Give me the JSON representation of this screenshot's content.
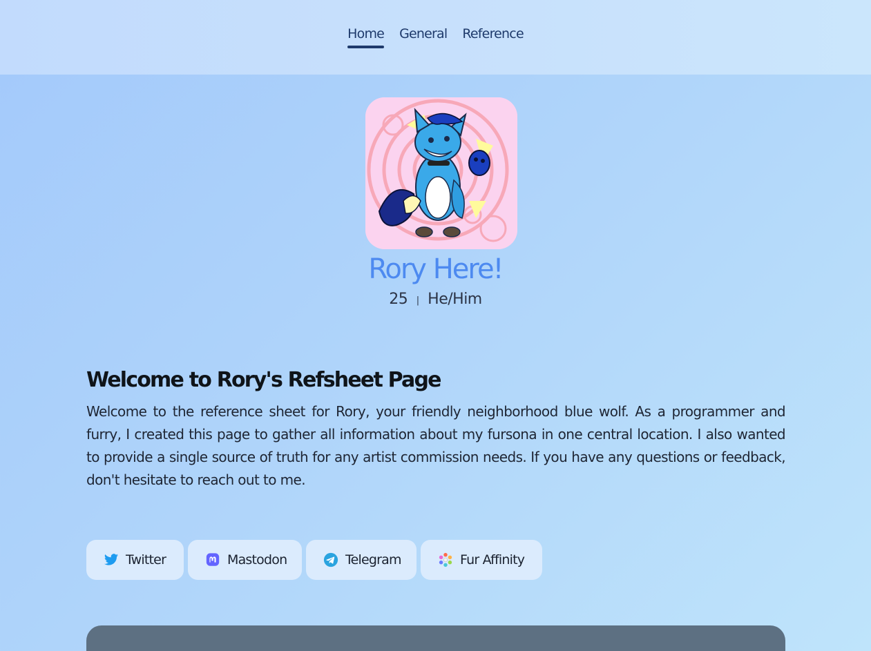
{
  "nav": {
    "items": [
      {
        "label": "Home",
        "active": true
      },
      {
        "label": "General",
        "active": false
      },
      {
        "label": "Reference",
        "active": false
      }
    ]
  },
  "profile": {
    "name": "Rory Here!",
    "age": "25",
    "separator": "|",
    "pronouns": "He/Him"
  },
  "intro": {
    "heading": "Welcome to Rory's Refsheet Page",
    "body": "Welcome to the reference sheet for Rory, your friendly neighborhood blue wolf. As a programmer and furry, I created this page to gather all information about my fursona in one central location. I also wanted to provide a single source of truth for any artist commission needs. If you have any questions or feedback, don't hesitate to reach out to me."
  },
  "socials": [
    {
      "label": "Twitter",
      "icon": "twitter-icon"
    },
    {
      "label": "Mastodon",
      "icon": "mastodon-icon"
    },
    {
      "label": "Telegram",
      "icon": "telegram-icon"
    },
    {
      "label": "Fur Affinity",
      "icon": "furaffinity-icon"
    }
  ],
  "colors": {
    "accent": "#4d8af0",
    "nav_text": "#1e3a6b",
    "button_bg": "#dbebfd",
    "card_bg": "#5d7082"
  }
}
